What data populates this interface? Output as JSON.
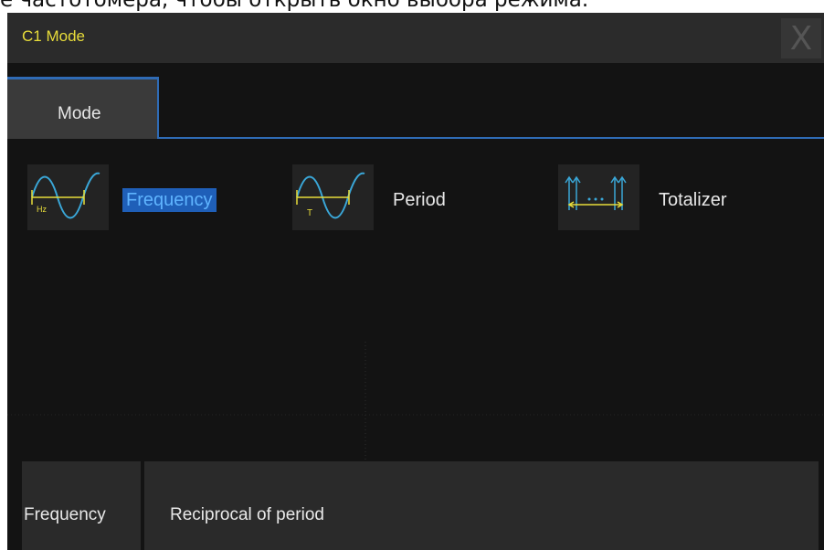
{
  "caption": "е частотомера, чтобы открыть окно выбора режима.",
  "dialog": {
    "title": "C1 Mode",
    "close_glyph": "X"
  },
  "tabs": [
    {
      "label": "Mode",
      "active": true
    }
  ],
  "modes": [
    {
      "label": "Frequency",
      "icon": "frequency-wave-icon",
      "icon_text": "Hz",
      "selected": true
    },
    {
      "label": "Period",
      "icon": "period-wave-icon",
      "icon_text": "T",
      "selected": false
    },
    {
      "label": "Totalizer",
      "icon": "totalizer-pulses-icon",
      "selected": false
    }
  ],
  "info": {
    "name": "Frequency",
    "description": "Reciprocal of period"
  },
  "colors": {
    "title_yellow": "#e8dd3a",
    "accent_blue": "#2f6bb5",
    "selection_blue": "#1f5fb8",
    "wave_cyan": "#3aa7d8"
  }
}
